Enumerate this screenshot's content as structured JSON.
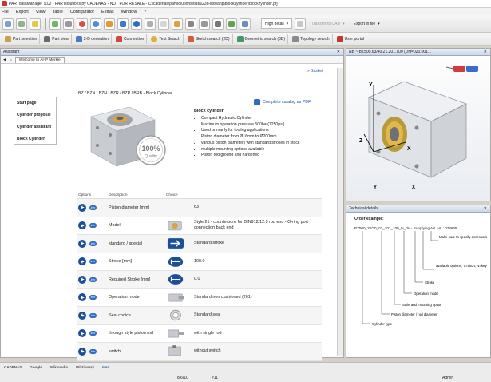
{
  "window": {
    "title": "PARTdataManager 9.02 - PARTsolutions by CADENAS - NOT FOR RESALE - C:\\cadenas\\partsolutions\\data\\23d-libs\\ahp\\blockzylinder\\blockzylinder.prj"
  },
  "menu": [
    "File",
    "Export",
    "View",
    "Table",
    "Configurator",
    "Extras",
    "Window",
    "?"
  ],
  "toolbar": {
    "high_detail": "High detail",
    "transfer_cad": "Transfer to CAD",
    "export_file": "Export in file"
  },
  "toolbar2": [
    "Part selection",
    "Part view",
    "2-D derivation",
    "Connection",
    "Text Search",
    "Sketch search (2D)",
    "Geometric search (3D)",
    "Topology search",
    "User portal"
  ],
  "left_pane": {
    "title": "Assistant",
    "tab": "Welcome to AHP Merkle",
    "basket": "» Basket",
    "nav": [
      "Start page",
      "Cylinder proposal",
      "Cylinder assistant",
      "Block Cylinder"
    ],
    "product_title": "BZ / BZN / BZH / BZR / BZP / BRB - Block Cylinder",
    "catalog_link": "Complete catalog as PDF",
    "desc_head": "Block cylinder",
    "bullets": [
      "Compact Hydraulic Cylinder",
      "Maximum operation pressure 500bar(7250psi)",
      "Used primarily for tooling applications",
      "Piston diameter from Ø16mm to Ø200mm",
      "various piston diameters with standard strokes in stock",
      "multiple mounting options available",
      "Piston rod ground and hardened"
    ],
    "quality": {
      "big": "100%",
      "sub": "Quality"
    },
    "columns": [
      "Options",
      "Description",
      "Choice"
    ],
    "rows": [
      {
        "desc": "Piston diameter [mm]",
        "value": "63",
        "choice": ""
      },
      {
        "desc": "Model",
        "value": "Style 21 - counterbore for DIN912/12.9 rod end - O-ring port connection back end",
        "choice": "cyl"
      },
      {
        "desc": "standard / special",
        "value": "Standard stroke",
        "choice": "arrow"
      },
      {
        "desc": "Stroke [mm]",
        "value": "100.0",
        "choice": "dim"
      },
      {
        "desc": "Required Stroke [mm]",
        "value": "0.0",
        "choice": "dim"
      },
      {
        "desc": "Operation mode",
        "value": "Standard non cushioned (201)",
        "choice": "cyl2"
      },
      {
        "desc": "Seal choice",
        "value": "Standard seal",
        "choice": "seal"
      },
      {
        "desc": "through style piston rod",
        "value": "with single rod",
        "choice": "rod"
      },
      {
        "desc": "switch",
        "value": "without switch",
        "choice": "switch"
      }
    ]
  },
  "right_top": {
    "title": "NB ~ BZ500.63/40.21.201.100 (DH=020.001...",
    "axes": {
      "y": "Y",
      "z": "Z",
      "x": "X"
    }
  },
  "right_bottom": {
    "title": "Technical details",
    "order_example": "Order example:",
    "code": "BZ500_32/20_03_201_100_N_0V - Supplying Art. Nr. : 078665",
    "notes": [
      "Make sure to specify accessories when ordering",
      "available options, V=viton, N=keyway",
      "Stroke",
      "Operation mode",
      "Style and mounting option",
      "Piston diameter / rod diameter",
      "Cylinder type"
    ]
  },
  "links": [
    "CADENAS",
    "Google",
    "Wikimedia",
    "Wiktionary",
    "msn"
  ],
  "status": {
    "date": "8/6/10",
    "num": "#11",
    "user": "Admin"
  },
  "colors": {
    "accent": "#1b4f9c",
    "link": "#1a4fa0"
  }
}
